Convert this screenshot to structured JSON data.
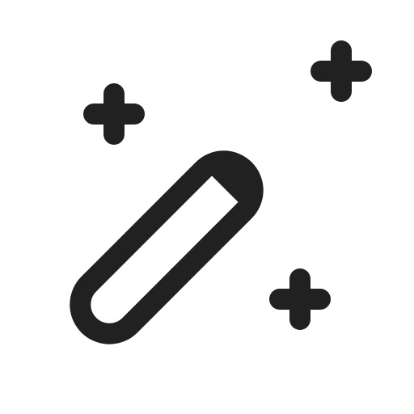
{
  "icon": {
    "name": "magic-wand-icon",
    "stroke_color": "#212121",
    "background_color": "#ffffff"
  },
  "sparkles": [
    {
      "name": "sparkle-top-left-icon"
    },
    {
      "name": "sparkle-top-right-icon"
    },
    {
      "name": "sparkle-bottom-right-icon"
    }
  ]
}
